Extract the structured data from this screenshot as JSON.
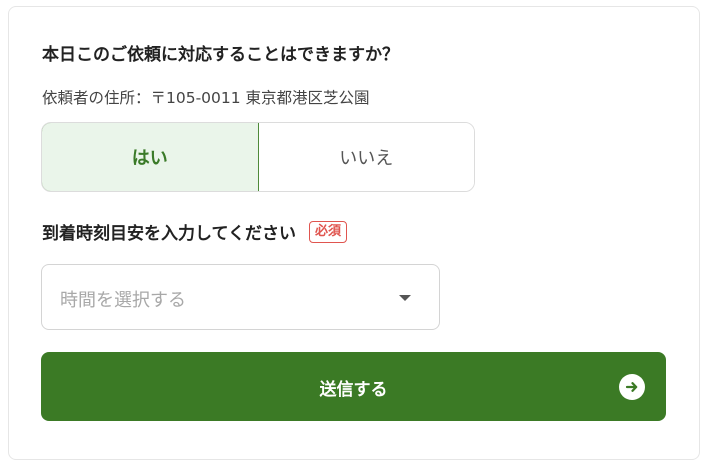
{
  "form": {
    "question": "本日このご依頼に対応することはできますか？",
    "address": "依頼者の住所：〒105-0011 東京都港区芝公園",
    "availability": {
      "yes_label": "はい",
      "no_label": "いいえ",
      "selected": "yes"
    },
    "arrival": {
      "label": "到着時刻目安を入力してください",
      "required_badge": "必須",
      "select_placeholder": "時間を選択する"
    },
    "submit_label": "送信する"
  },
  "colors": {
    "accent": "#3b7a25",
    "selected_bg": "#eaf5ea",
    "required": "#e0554f"
  },
  "icons": {
    "dropdown": "caret-down-icon",
    "submit": "arrow-right-circle-icon"
  }
}
